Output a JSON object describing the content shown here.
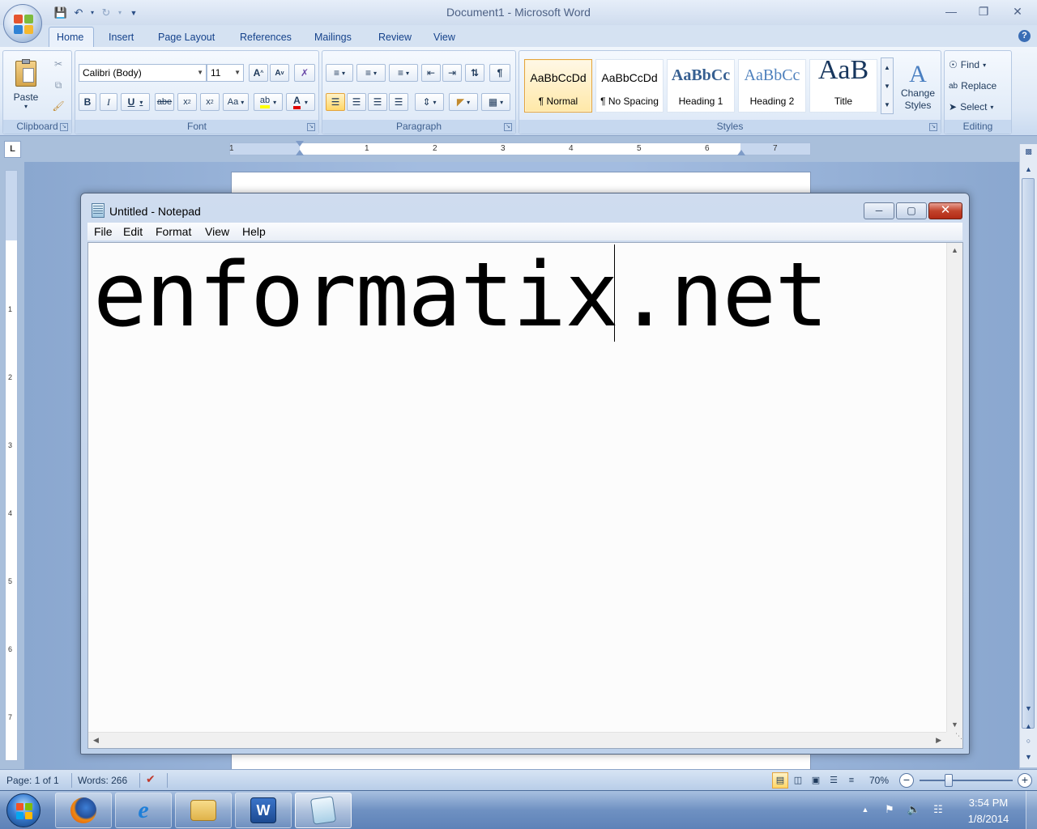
{
  "word": {
    "title": "Document1 - Microsoft Word",
    "tabs": [
      "Home",
      "Insert",
      "Page Layout",
      "References",
      "Mailings",
      "Review",
      "View"
    ],
    "groups": {
      "clipboard": "Clipboard",
      "font": "Font",
      "paragraph": "Paragraph",
      "styles": "Styles",
      "editing": "Editing"
    },
    "paste_label": "Paste",
    "font_name": "Calibri (Body)",
    "font_size": "11",
    "styles": [
      {
        "sample": "AaBbCcDd",
        "name": "¶ Normal"
      },
      {
        "sample": "AaBbCcDd",
        "name": "¶ No Spacing"
      },
      {
        "sample": "AaBbCc",
        "name": "Heading 1"
      },
      {
        "sample": "AaBbCc",
        "name": "Heading 2"
      },
      {
        "sample": "AaB",
        "name": "Title"
      }
    ],
    "change_styles": "Change Styles",
    "find": "Find",
    "replace": "Replace",
    "select": "Select",
    "ruler_numbers": [
      "1",
      "1",
      "2",
      "3",
      "4",
      "5",
      "6",
      "7"
    ],
    "vruler_numbers": [
      "1",
      "2",
      "3",
      "4",
      "5",
      "6",
      "7"
    ],
    "status": {
      "page": "Page: 1 of 1",
      "words": "Words: 266",
      "zoom": "70%"
    }
  },
  "notepad": {
    "title": "Untitled - Notepad",
    "menu": [
      "File",
      "Edit",
      "Format",
      "View",
      "Help"
    ],
    "content": "enformatix.net"
  },
  "taskbar": {
    "time": "3:54 PM",
    "date": "1/8/2014",
    "apps": [
      "firefox-icon",
      "internet-explorer-icon",
      "file-explorer-icon",
      "word-icon",
      "notepad-icon"
    ]
  },
  "colors": {
    "accent": "#15428b",
    "active_style": "#e4a43d",
    "close_red": "#c2432b"
  }
}
